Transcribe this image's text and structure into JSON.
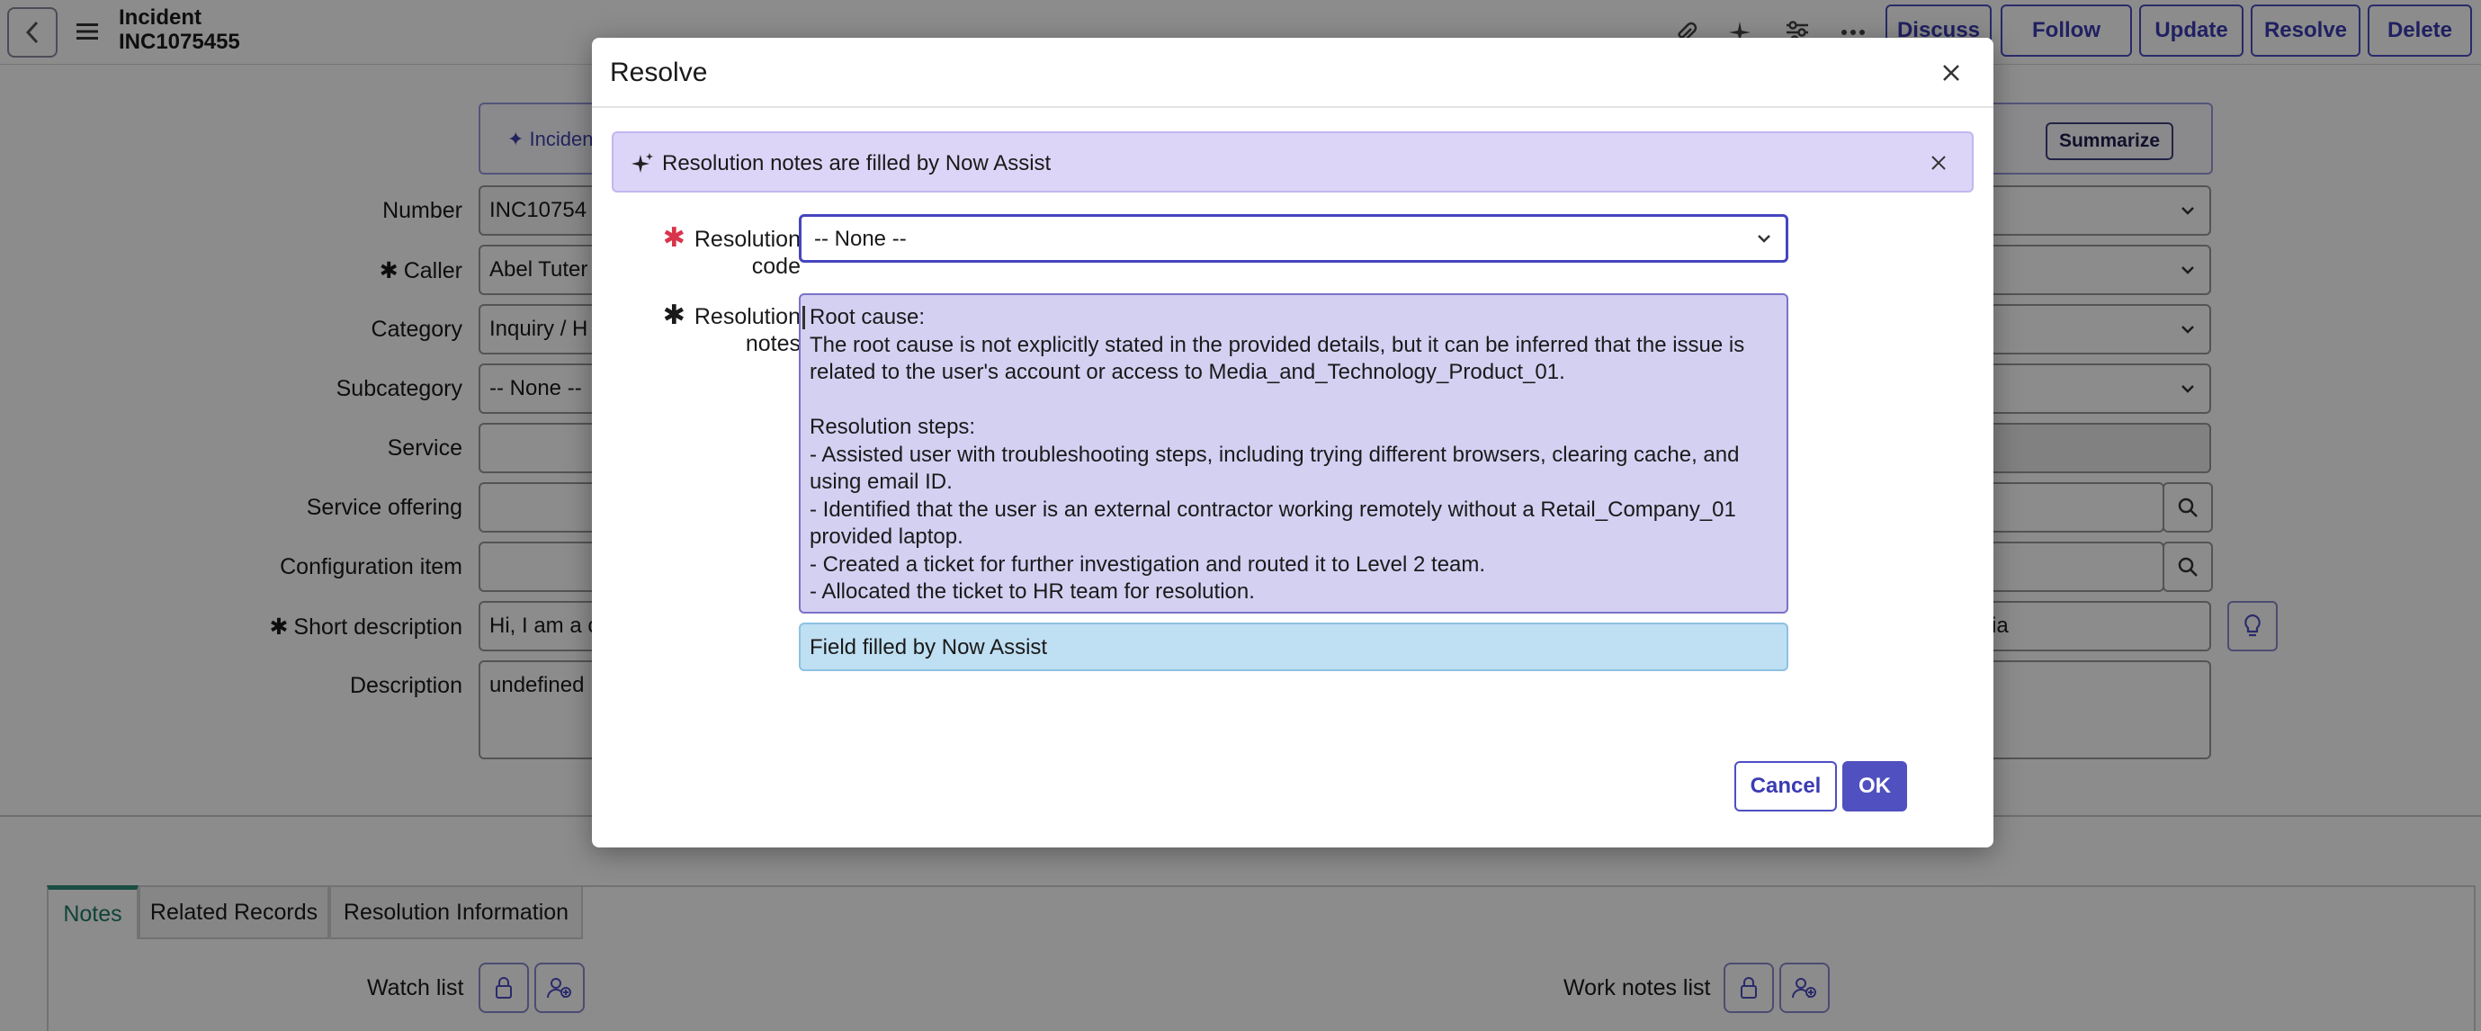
{
  "header": {
    "record_type": "Incident",
    "record_number": "INC1075455",
    "buttons": [
      "Discuss",
      "Follow",
      "Update",
      "Resolve",
      "Delete"
    ]
  },
  "ai_card": {
    "label": "Inciden",
    "summarize_label": "Summarize"
  },
  "form": {
    "number_label": "Number",
    "number_value": "INC10754",
    "caller_label": "Caller",
    "caller_value": "Abel Tuter",
    "category_label": "Category",
    "category_value": "Inquiry / H",
    "subcategory_label": "Subcategory",
    "subcategory_value": "-- None --",
    "service_label": "Service",
    "service_offering_label": "Service offering",
    "config_item_label": "Configuration item",
    "short_desc_label": "Short description",
    "short_desc_value": "Hi,  I am a c",
    "short_desc_right_value": "ia",
    "description_label": "Description",
    "description_value": "undefined"
  },
  "tabs": [
    "Notes",
    "Related Records",
    "Resolution Information"
  ],
  "lists": {
    "watch_list_label": "Watch list",
    "work_notes_list_label": "Work notes list"
  },
  "modal": {
    "title": "Resolve",
    "banner_text": "Resolution notes are filled by Now Assist",
    "resolution_code_label_1": "Resolution",
    "resolution_code_label_2": "code",
    "resolution_code_value": "-- None --",
    "resolution_notes_label_1": "Resolution",
    "resolution_notes_label_2": "notes",
    "notes": {
      "line1": "Root cause:",
      "line2": "The root cause is not explicitly stated in the provided details, but it can be inferred that the issue is",
      "line3": "related to the user's account or access to Media_and_Technology_Product_01.",
      "line4": "",
      "line5": "Resolution steps:",
      "line6": "- Assisted user with troubleshooting steps, including trying different browsers, clearing cache, and",
      "line7": "using email ID.",
      "line8": "- Identified that the user is an external contractor working remotely without a Retail_Company_01",
      "line9": "provided laptop.",
      "line10": "- Created a ticket for further investigation and routed it to Level 2 team.",
      "line11": "- Allocated the ticket to HR team for resolution."
    },
    "filled_note": "Field filled by Now Assist",
    "cancel_label": "Cancel",
    "ok_label": "OK"
  },
  "colors": {
    "accent": "#4e4ec4",
    "banner_bg": "#ddd5f7",
    "notes_bg": "#d4d0f2",
    "filled_note_bg": "#bfdff2",
    "required_star": "#d9344a",
    "active_tab": "#2f8f7a"
  }
}
